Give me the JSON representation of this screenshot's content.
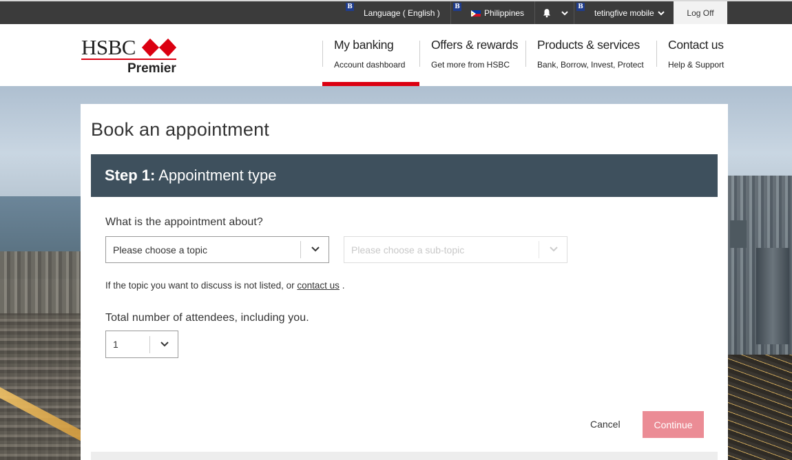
{
  "topbar": {
    "language_label": "Language ( English )",
    "country_label": "Philippines",
    "user_label": "tetingfive mobile",
    "logoff_label": "Log Off",
    "badge_letter": "B"
  },
  "brand": {
    "name": "HSBC",
    "tier": "Premier",
    "accent_color": "#db0011"
  },
  "nav": {
    "items": [
      {
        "title": "My banking",
        "subtitle": "Account dashboard",
        "active": true
      },
      {
        "title": "Offers & rewards",
        "subtitle": "Get more from HSBC",
        "active": false
      },
      {
        "title": "Products & services",
        "subtitle": "Bank, Borrow, Invest, Protect",
        "active": false
      },
      {
        "title": "Contact us",
        "subtitle": "Help & Support",
        "active": false
      }
    ]
  },
  "page": {
    "title": "Book an appointment",
    "step_prefix": "Step 1:",
    "step_title": " Appointment type",
    "step_bar_color": "#3e505d"
  },
  "form": {
    "topic_question": "What is the appointment about?",
    "topic_value": "Please choose a topic",
    "subtopic_placeholder": "Please choose a sub-topic",
    "help_prefix": "If the topic you want to discuss is not listed, or ",
    "help_link": "contact us",
    "help_suffix": " .",
    "attendees_question": "Total number of attendees, including you.",
    "attendees_value": "1"
  },
  "actions": {
    "cancel_label": "Cancel",
    "continue_label": "Continue",
    "continue_color": "#eb8c95"
  }
}
